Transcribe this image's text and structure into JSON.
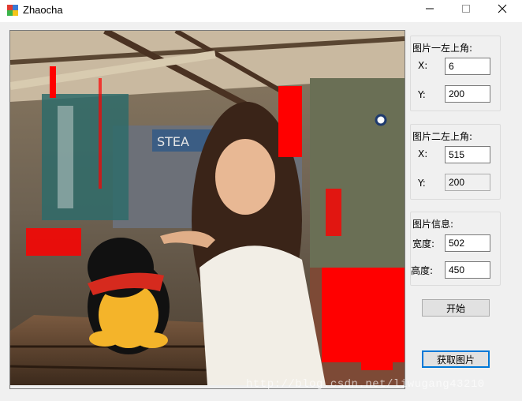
{
  "window": {
    "title": "Zhaocha",
    "icon": "app-cubes-icon",
    "controls": [
      "minimize-icon",
      "maximize-icon",
      "close-icon"
    ]
  },
  "picture": {
    "description_icon": "photo",
    "mark_color": "#ff0000"
  },
  "group1": {
    "title": "图片一左上角:",
    "x_label": "X:",
    "x_value": "6",
    "y_label": "Y:",
    "y_value": "200"
  },
  "group2": {
    "title": "图片二左上角:",
    "x_label": "X:",
    "x_value": "515",
    "y_label": "Y:",
    "y_value": "200"
  },
  "group3": {
    "title": "图片信息:",
    "width_label": "宽度:",
    "width_value": "502",
    "height_label": "高度:",
    "height_value": "450"
  },
  "buttons": {
    "start": "开始",
    "get_image": "获取图片"
  },
  "watermark": "http://blog.csdn.net/liwugang43210"
}
